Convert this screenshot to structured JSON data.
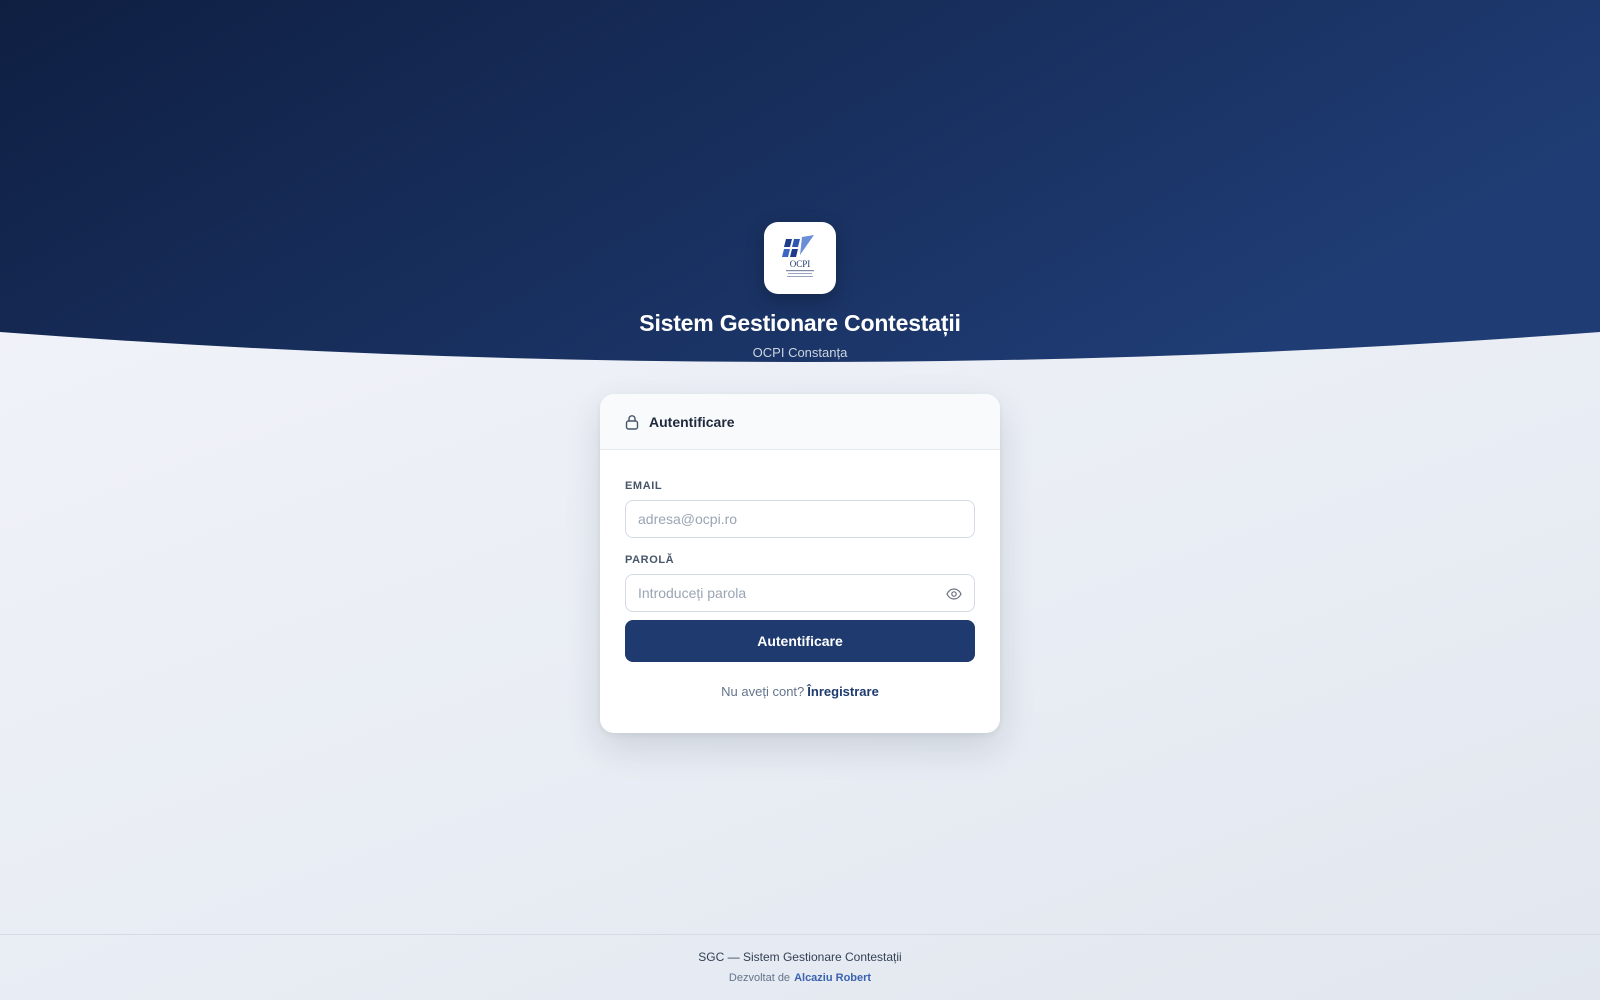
{
  "brand": {
    "logo_text": "OCPI",
    "title": "Sistem Gestionare Contestații",
    "subtitle": "OCPI Constanța"
  },
  "login_card": {
    "header_icon": "lock-icon",
    "header_title": "Autentificare",
    "email": {
      "label": "EMAIL",
      "value": "",
      "placeholder": "adresa@ocpi.ro"
    },
    "password": {
      "label": "PAROLĂ",
      "value": "",
      "placeholder": "Introduceți parola",
      "toggle_icon": "eye-icon"
    },
    "submit_label": "Autentificare",
    "register_prompt": "Nu aveți cont?",
    "register_link": "Înregistrare"
  },
  "footer": {
    "app_name": "SGC — Sistem Gestionare Contestații",
    "developed_by_label": "Dezvoltat de",
    "developer": "Alcaziu Robert"
  },
  "colors": {
    "hero_dark": "#0f1f42",
    "hero_light": "#1f3c74",
    "primary_button": "#1e3a6e",
    "link": "#1e3a6e",
    "footer_link": "#3b63b0"
  }
}
